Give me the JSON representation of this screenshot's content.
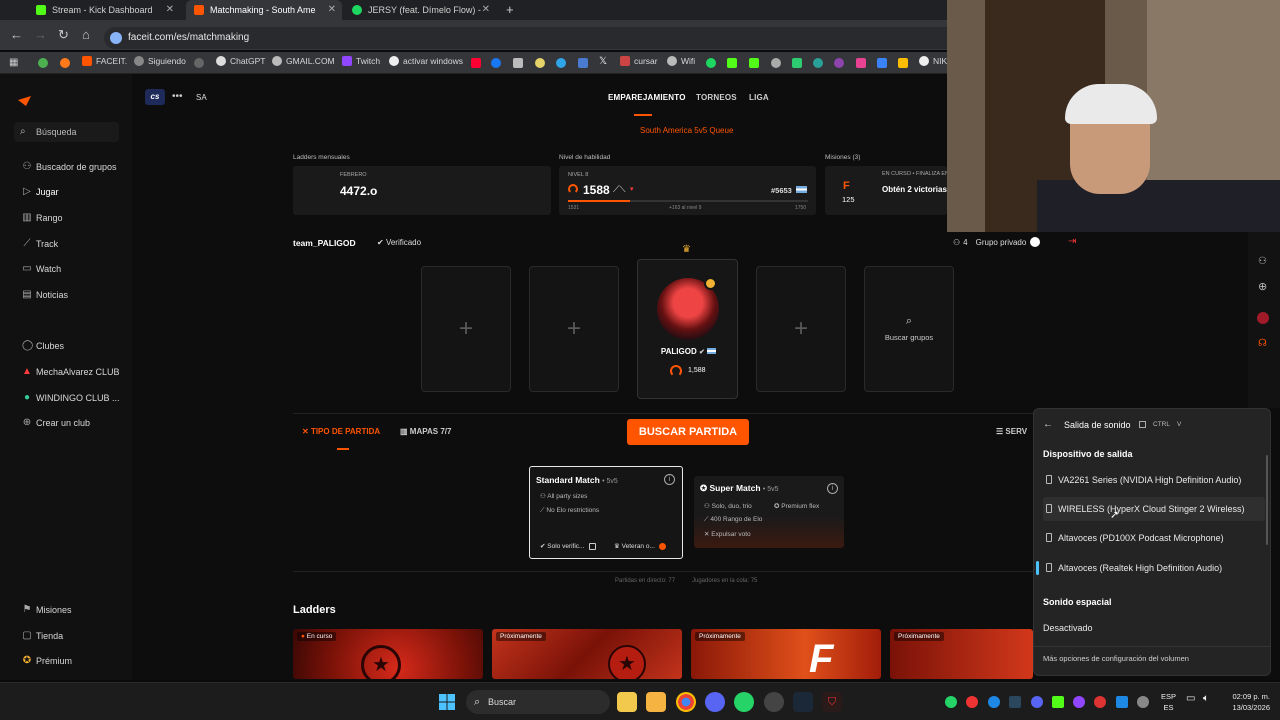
{
  "browser": {
    "tabs": [
      {
        "label": "Stream - Kick Dashboard",
        "color": "#53fc18"
      },
      {
        "label": "Matchmaking - South Ame",
        "color": "#ff5500"
      },
      {
        "label": "JERSY (feat. Dímelo Flow) -",
        "color": "#1ed760"
      }
    ],
    "new_tab": "+",
    "url": "faceit.com/es/matchmaking",
    "bookmarks": [
      "FACEIT.",
      "Siguiendo",
      "ChatGPT",
      "GMAIL.COM",
      "Twitch",
      "activar windows",
      "cursar",
      "Wifi",
      "NIK"
    ]
  },
  "sidebar": {
    "search_placeholder": "Búsqueda",
    "items": [
      "Buscador de grupos",
      "Jugar",
      "Rango",
      "Track",
      "Watch",
      "Noticias"
    ],
    "clubs_header": "Clubes",
    "clubs": [
      "MechaAlvarez CLUB",
      "WINDINGO CLUB ..."
    ],
    "create_club": "Crear un club",
    "footer": [
      "Misiones",
      "Tienda",
      "Prémium"
    ]
  },
  "game": {
    "logo": "cs",
    "region": "SA"
  },
  "topnav": {
    "tabs": [
      "EMPAREJAMIENTO",
      "TORNEOS",
      "LIGA"
    ],
    "queue": "South America 5v5 Queue"
  },
  "stats": {
    "ladders_label": "Ladders mensuales",
    "ladders_month": "FEBRERO",
    "ladders_value": "4472.o",
    "skill_label": "Nivel de habilidad",
    "skill_level": "NIVEL 8",
    "elo": "1588",
    "rank": "#5653",
    "skill_min": "1531",
    "skill_next": "+163 al nivel 9",
    "skill_max": "1750",
    "missions_label": "Misiones (3)",
    "mission_tag": "EN CURSO • FINALIZA EN",
    "mission_title": "Obtén 2 victorias",
    "mission_count": "125",
    "mission_letter": "F"
  },
  "party": {
    "team_name": "team_PALIGOD",
    "verified": "Verificado",
    "player_name": "PALIGOD",
    "player_elo": "1,588",
    "find_groups": "Buscar grupos",
    "private_count": "4",
    "private_label": "Grupo privado"
  },
  "match": {
    "tipo": "TIPO DE PARTIDA",
    "maps": "MAPAS 7/7",
    "find_button": "BUSCAR PARTIDA",
    "serv": "SERV",
    "standard_title": "Standard Match",
    "standard_mode": "• 5v5",
    "standard_lines": [
      "All party sizes",
      "No Elo restrictions"
    ],
    "standard_opt1": "Solo verific...",
    "standard_opt2": "Veteran o...",
    "super_title": "Super Match",
    "super_mode": "• 5v5",
    "super_lines": [
      "Solo, duo, trio",
      "400 Rango de Elo",
      "Expulsar voto"
    ],
    "super_flex": "Premium flex",
    "live_count": "Partidas en directo: 77",
    "queue_count": "Jugadores en la cola: 75"
  },
  "ladders": {
    "heading": "Ladders",
    "cards": [
      "En curso",
      "Próximamente",
      "Próximamente",
      "Próximamente"
    ]
  },
  "sound_panel": {
    "title": "Salida de sonido",
    "shortcut_ctrl": "CTRL",
    "shortcut_v": "V",
    "output_header": "Dispositivo de salida",
    "devices": [
      "VA2261 Series (NVIDIA High Definition Audio)",
      "WIRELESS (HyperX Cloud Stinger 2 Wireless)",
      "Altavoces (PD100X Podcast Microphone)",
      "Altavoces (Realtek High Definition Audio)"
    ],
    "spatial_header": "Sonido espacial",
    "spatial_value": "Desactivado",
    "more": "Más opciones de configuración del volumen"
  },
  "taskbar": {
    "search": "Buscar",
    "lang_top": "ESP",
    "lang_bottom": "ES",
    "time": "02:09 p. m.",
    "date": "13/03/2026"
  }
}
